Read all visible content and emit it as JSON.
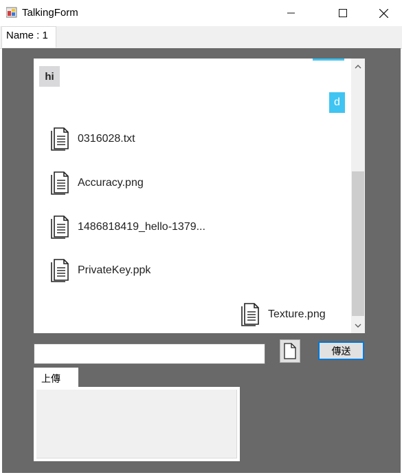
{
  "window": {
    "title": "TalkingForm",
    "minimize_icon": "minimize-icon",
    "maximize_icon": "maximize-icon",
    "close_icon": "close-icon"
  },
  "tabs": [
    {
      "label": "Name : 1"
    }
  ],
  "chat": {
    "messages": [
      {
        "text": "hi",
        "side": "left",
        "color": "#d9d9dc"
      },
      {
        "text": "d",
        "side": "right",
        "color": "#40c4f2"
      }
    ],
    "files": [
      {
        "name": "0316028.txt",
        "side": "left",
        "icon": "document-icon"
      },
      {
        "name": "Accuracy.png",
        "side": "left",
        "icon": "document-icon"
      },
      {
        "name": "1486818419_hello-1379...",
        "side": "left",
        "icon": "document-icon"
      },
      {
        "name": "PrivateKey.ppk",
        "side": "left",
        "icon": "document-icon"
      },
      {
        "name": "Texture.png",
        "side": "right",
        "icon": "document-icon"
      }
    ]
  },
  "composer": {
    "input_value": "",
    "attach_icon": "file-icon",
    "send_label": "傳送"
  },
  "upload": {
    "tab_label": "上傳"
  },
  "colors": {
    "panel_bg": "#696969",
    "my_bubble": "#40c4f2",
    "other_bubble": "#d9d9dc",
    "focus_border": "#0078d7"
  }
}
